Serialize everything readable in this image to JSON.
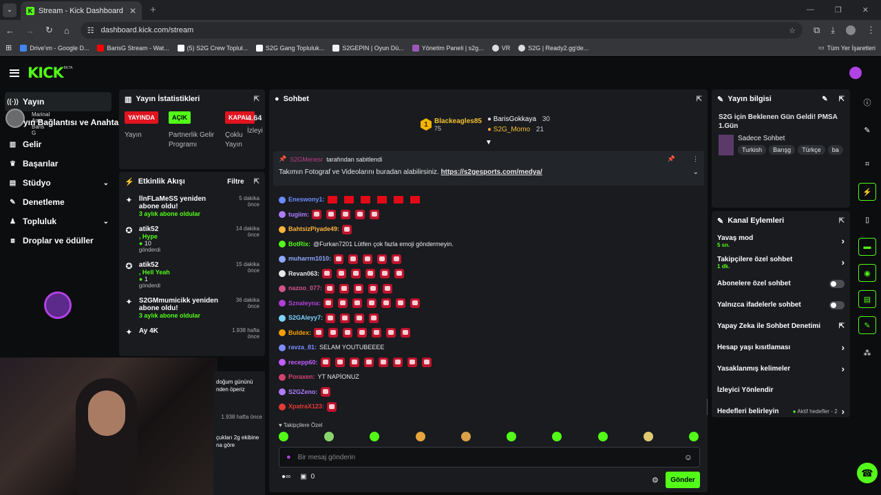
{
  "browser": {
    "tab_title": "Stream - Kick Dashboard",
    "url": "dashboard.kick.com/stream",
    "bookmarks": [
      "Drive'ım - Google D...",
      "BarisG Stream - Wat...",
      "(5) S2G Crew Topluł...",
      "S2G Gang Topluluk...",
      "S2GEPIN | Oyun Dü...",
      "Yönetim Paneli | s2g...",
      "VR",
      "S2G | Ready2.gg'de..."
    ],
    "all_bookmarks": "Tüm Yer İşaretleri"
  },
  "header": {
    "logo": "KICK",
    "beta": "BETA"
  },
  "sidebar": {
    "items": [
      {
        "label": "Yayın",
        "icon": "broadcast-icon"
      },
      {
        "label": "Gelir",
        "icon": "chart-icon"
      },
      {
        "label": "Başarılar",
        "icon": "trophy-icon"
      },
      {
        "label": "Stüdyo",
        "icon": "studio-icon"
      },
      {
        "label": "Denetleme",
        "icon": "wrench-icon"
      },
      {
        "label": "Topluluk",
        "icon": "community-icon"
      },
      {
        "label": "Droplar ve ödüller",
        "icon": "gift-icon"
      }
    ],
    "overlay_user": "Marinal Ama Baris G",
    "overlay_text": "yın Bağlantısı ve Anahtarı"
  },
  "stats": {
    "title": "Yayın İstatistikleri",
    "badges": [
      {
        "text": "YAYINDA",
        "label": "Yayın",
        "color": "#e0131f"
      },
      {
        "text": "AÇIK",
        "label": "Partnerlik Gelir Programı",
        "color": "#53fc18"
      },
      {
        "text": "KAPALI",
        "label": "Çoklu Yayın",
        "color": "#e0131f"
      }
    ],
    "viewers_value": "4.64",
    "viewers_label": "İzleyi"
  },
  "activity": {
    "title": "Etkinlik Akışı",
    "filter": "Filtre",
    "items": [
      {
        "name": "llnFLaMeSS yeniden abone oldu!",
        "sub": "3 aylık abone oldular",
        "time": "5 dakika önce"
      },
      {
        "name": "atik52",
        "sub": ", Hype",
        "count": "10",
        "extra": "gönderdi",
        "time": "14 dakika önce"
      },
      {
        "name": "atik52",
        "sub": ", Hell Yeah",
        "count": "1",
        "extra": "gönderdi",
        "time": "15 dakika önce"
      },
      {
        "name": "S2GMmumicikk yeniden abone oldu!",
        "sub": "3 aylık abone oldular",
        "time": "36 dakika önce"
      },
      {
        "name": "Ay 4K",
        "time": "1.938 hafta önce"
      },
      {
        "name": "doğum gününü nden öperiz",
        "time": ""
      },
      {
        "name": "",
        "time": "1.938 hafta önce"
      },
      {
        "name": "çukları 2g ekibine na göre",
        "time": ""
      }
    ]
  },
  "chat": {
    "title": "Sohbet",
    "leaders": [
      {
        "rank": "1",
        "name": "Blackeagles85",
        "value": "75"
      },
      {
        "name": "BarisGokkaya",
        "value": "30"
      },
      {
        "name": "S2G_Momo",
        "value": "21"
      }
    ],
    "pinned_by": "S2GMenesr",
    "pinned_by_suffix": "tarafından sabitlendi",
    "pinned_text": "Takımın Fotograf ve Videolarını buradan alabilirsiniz.",
    "pinned_link": "https://s2gesports.com/medya/",
    "messages": [
      {
        "user": "Eneswony1:",
        "color": "#6b8cff",
        "kind": "flag",
        "emotes": 6
      },
      {
        "user": "tugiim:",
        "color": "#b07cff",
        "emotes": 5
      },
      {
        "user": "BahtsizPiyade49:",
        "color": "#ffb339",
        "emotes": 1
      },
      {
        "user": "BotRix:",
        "color": "#53fc18",
        "text": "@Furkan7201 Lütfen çok fazla emoji göndermeyin.",
        "emotes": 0
      },
      {
        "user": "muharrm1010:",
        "color": "#8fa7ff",
        "emotes": 5
      },
      {
        "user": "Revan063:",
        "color": "#e8e8e8",
        "emotes": 6
      },
      {
        "user": "nazoo_077:",
        "color": "#d2548c",
        "emotes": 5
      },
      {
        "user": "Sznaleyna:",
        "color": "#b03fd6",
        "emotes": 7
      },
      {
        "user": "S2GAleyy7:",
        "color": "#7dd3fc",
        "emotes": 4
      },
      {
        "user": "Buldex:",
        "color": "#f7a000",
        "emotes": 7
      },
      {
        "user": "ravza_81:",
        "color": "#7b8cff",
        "text": "SELAM YOUTUBEEEE",
        "emotes": 0
      },
      {
        "user": "recepp60:",
        "color": "#c45dff",
        "emotes": 8
      },
      {
        "user": "Poraxen:",
        "color": "#d2436b",
        "text": "YT NAPİONUZ",
        "emotes": 0
      },
      {
        "user": "S2GZeno:",
        "color": "#b07cff",
        "emotes": 1
      },
      {
        "user": "XpatraX123:",
        "color": "#e53935",
        "emotes": 1
      }
    ],
    "followers_only": "Takipçilere Özel",
    "input_placeholder": "Bir mesaj gönderin",
    "points": "0",
    "send": "Gönder"
  },
  "stream_info": {
    "title": "Yayın bilgisi",
    "stream_title": "S2G için Beklenen Gün Geldi! PMSA 1.Gün",
    "category": "Sadece Sohbet",
    "tags": [
      "Turkish",
      "Barışg",
      "Türkçe",
      "ba"
    ]
  },
  "channel_actions": {
    "title": "Kanal Eylemleri",
    "items": [
      {
        "label": "Yavaş mod",
        "sub": "5 sn.",
        "type": "chevron"
      },
      {
        "label": "Takipçilere özel sohbet",
        "sub": "1 dk.",
        "type": "chevron"
      },
      {
        "label": "Abonelere özel sohbet",
        "type": "toggle"
      },
      {
        "label": "Yalnızca ifadelerle sohbet",
        "type": "toggle"
      },
      {
        "label": "Yapay Zeka ile Sohbet Denetimi",
        "type": "external"
      },
      {
        "label": "Hesap yaşı kısıtlaması",
        "type": "chevron"
      },
      {
        "label": "Yasaklanmış kelimeler",
        "type": "chevron"
      },
      {
        "label": "İzleyici Yönlendir",
        "type": "none"
      },
      {
        "label": "Hedefleri belirleyin",
        "sub": "Aktif hedefler - 2",
        "type": "chevron"
      }
    ]
  },
  "colors": {
    "accent": "#53fc18",
    "panel": "#191b1f",
    "bg": "#0b0d0e",
    "live": "#e0131f"
  }
}
